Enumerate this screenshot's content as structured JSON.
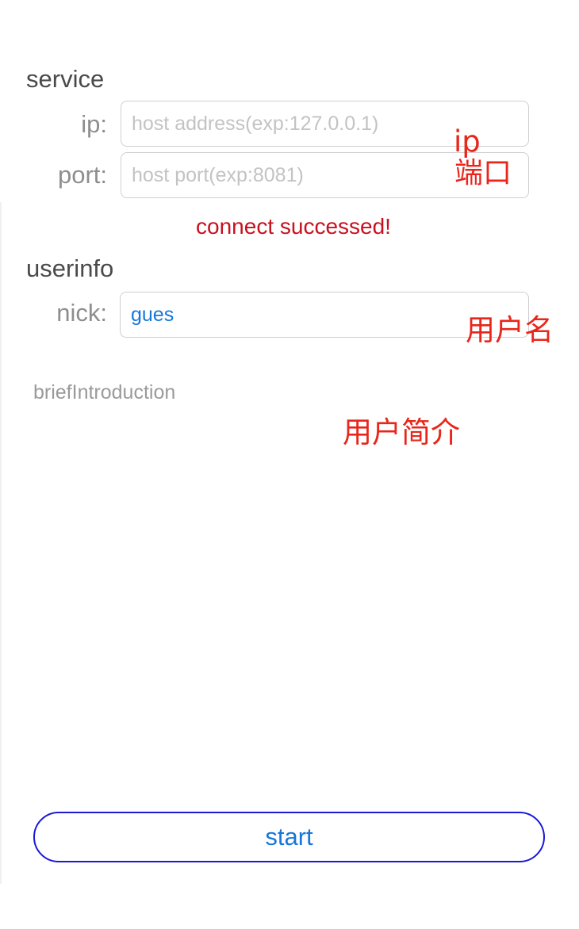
{
  "service": {
    "title": "service",
    "ip_label": "ip:",
    "ip_placeholder": "host address(exp:127.0.0.1)",
    "ip_value": "",
    "port_label": "port:",
    "port_placeholder": "host port(exp:8081)",
    "port_value": "",
    "status": "connect successed!"
  },
  "userinfo": {
    "title": "userinfo",
    "nick_label": "nick:",
    "nick_value": "gues",
    "brief_label": "briefIntroduction"
  },
  "annotations": {
    "ip": "ip",
    "port": "端口",
    "nick": "用户名",
    "brief": "用户简介"
  },
  "actions": {
    "start_label": "start"
  },
  "colors": {
    "accent": "#1677d9",
    "button_border": "#1b18d6",
    "status": "#c8101e",
    "annotation": "#e8261b"
  }
}
